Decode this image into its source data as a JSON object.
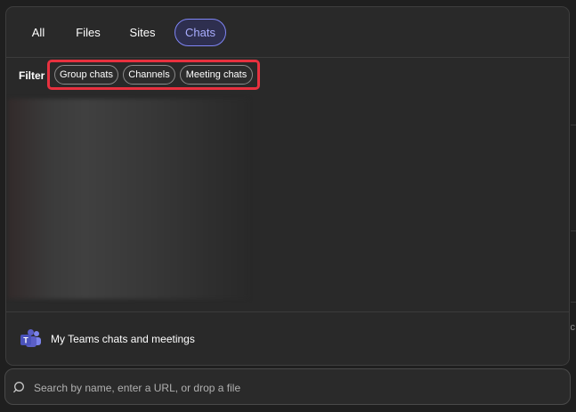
{
  "tabs": [
    {
      "label": "All",
      "active": false
    },
    {
      "label": "Files",
      "active": false
    },
    {
      "label": "Sites",
      "active": false
    },
    {
      "label": "Chats",
      "active": true
    }
  ],
  "filter": {
    "label": "Filter",
    "chips": [
      {
        "label": "Group chats"
      },
      {
        "label": "Channels"
      },
      {
        "label": "Meeting chats"
      }
    ]
  },
  "teams_link": {
    "label": "My Teams chats and meetings",
    "icon": "microsoft-teams-icon"
  },
  "search": {
    "placeholder": "Search by name, enter a URL, or drop a file",
    "value": "",
    "icon": "search-icon"
  },
  "colors": {
    "accent": "#7f85f5",
    "highlight": "#e8313f",
    "teams": "#5b5fc7"
  }
}
